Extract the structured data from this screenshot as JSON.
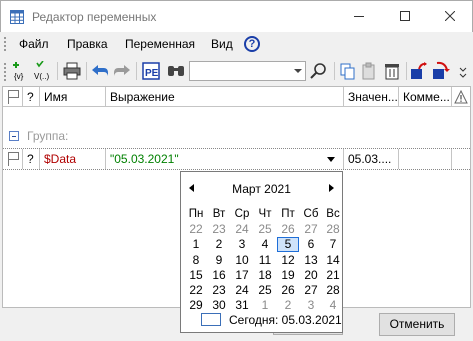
{
  "window": {
    "title": "Редактор переменных",
    "icon": "table-app-icon"
  },
  "menu": {
    "items": [
      "Файл",
      "Правка",
      "Переменная",
      "Вид"
    ],
    "help_icon": "?"
  },
  "toolbar": {
    "search": {
      "value": "",
      "placeholder": ""
    },
    "icons": [
      "add-variable-icon",
      "add-expression-variable-icon",
      "print-icon",
      "undo-icon",
      "redo-icon",
      "expression-view-icon",
      "find-icon",
      "search-combo",
      "search-go-icon",
      "copy-icon",
      "paste-icon",
      "delete-icon",
      "move-up-icon",
      "move-down-icon"
    ]
  },
  "grid": {
    "columns": [
      {
        "key": "flag",
        "label": ""
      },
      {
        "key": "q",
        "label": "?"
      },
      {
        "key": "name",
        "label": "Имя"
      },
      {
        "key": "expr",
        "label": "Выражение"
      },
      {
        "key": "value",
        "label": "Значен..."
      },
      {
        "key": "comment",
        "label": "Комме..."
      },
      {
        "key": "warn",
        "label": ""
      }
    ],
    "group": {
      "label": "Группа:"
    },
    "row": {
      "q": "?",
      "name": "$Data",
      "expression": "\"05.03.2021\"",
      "value": "05.03....",
      "comment": ""
    }
  },
  "calendar": {
    "title": "Март 2021",
    "weekdays": [
      "Пн",
      "Вт",
      "Ср",
      "Чт",
      "Пт",
      "Сб",
      "Вс"
    ],
    "weeks": [
      [
        "22",
        "23",
        "24",
        "25",
        "26",
        "27",
        "28"
      ],
      [
        "1",
        "2",
        "3",
        "4",
        "5",
        "6",
        "7"
      ],
      [
        "8",
        "9",
        "10",
        "11",
        "12",
        "13",
        "14"
      ],
      [
        "15",
        "16",
        "17",
        "18",
        "19",
        "20",
        "21"
      ],
      [
        "22",
        "23",
        "24",
        "25",
        "26",
        "27",
        "28"
      ],
      [
        "29",
        "30",
        "31",
        "1",
        "2",
        "3",
        "4"
      ]
    ],
    "other_month_week0": true,
    "other_month_week5_from": 3,
    "selected_day": "5",
    "today_label": "Сегодня: 05.03.2021"
  },
  "buttons": {
    "cancel": "Отменить",
    "ok": ""
  },
  "colors": {
    "name_red": "#b00000",
    "expression_green": "#008000",
    "selection_blue": "#1e6ed8"
  }
}
